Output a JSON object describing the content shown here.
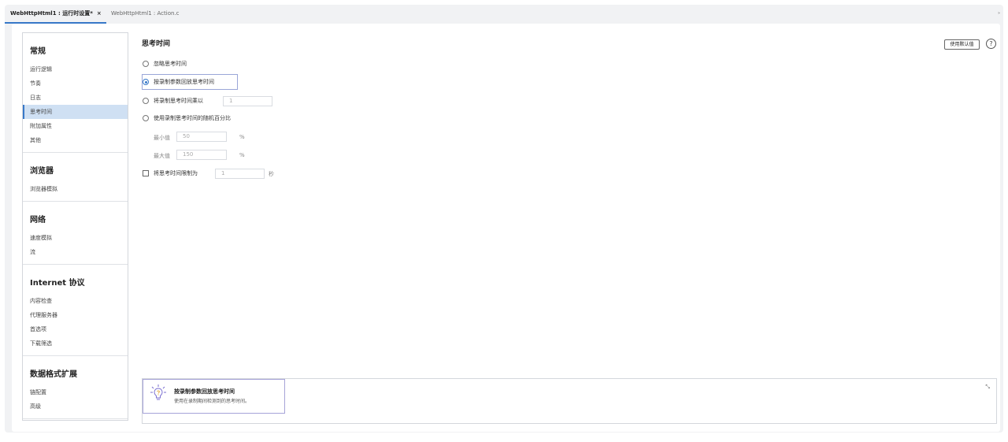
{
  "tabs": [
    {
      "label": "WebHttpHtml1 : 运行时设置*",
      "close": "×"
    },
    {
      "label": "WebHttpHtml1 : Action.c"
    }
  ],
  "tab_menu": "»",
  "sidebar": {
    "sections": [
      {
        "title": "常规",
        "items": [
          "运行逻辑",
          "节奏",
          "日志",
          "思考时间",
          "附加属性",
          "其他"
        ]
      },
      {
        "title": "浏览器",
        "items": [
          "浏览器模拟"
        ]
      },
      {
        "title": "网络",
        "items": [
          "速度模拟",
          "流"
        ]
      },
      {
        "title": "Internet 协议",
        "items": [
          "内容检查",
          "代理服务器",
          "首选项",
          "下载筛选"
        ]
      },
      {
        "title": "数据格式扩展",
        "items": [
          "链配置",
          "高级"
        ]
      }
    ],
    "selected": "思考时间"
  },
  "content": {
    "title": "思考时间",
    "default_button": "使用默认值",
    "help": "?",
    "options": {
      "ignore": "忽略思考时间",
      "replay": "按录制参数回放思考时间",
      "multiply": "将录制思考时间乘以",
      "multiply_value": "1",
      "random": "使用录制思考时间的随机百分比",
      "min_label": "最小值",
      "min_value": "50",
      "max_label": "最大值",
      "max_value": "150",
      "percent": "%",
      "limit": "将思考时间限制为",
      "limit_value": "1",
      "seconds": "秒"
    },
    "selected_option": "replay"
  },
  "info": {
    "title": "按录制参数回放思考时间",
    "desc": "使用在录制期间检测到的思考时间。",
    "collapse": "⤡"
  }
}
